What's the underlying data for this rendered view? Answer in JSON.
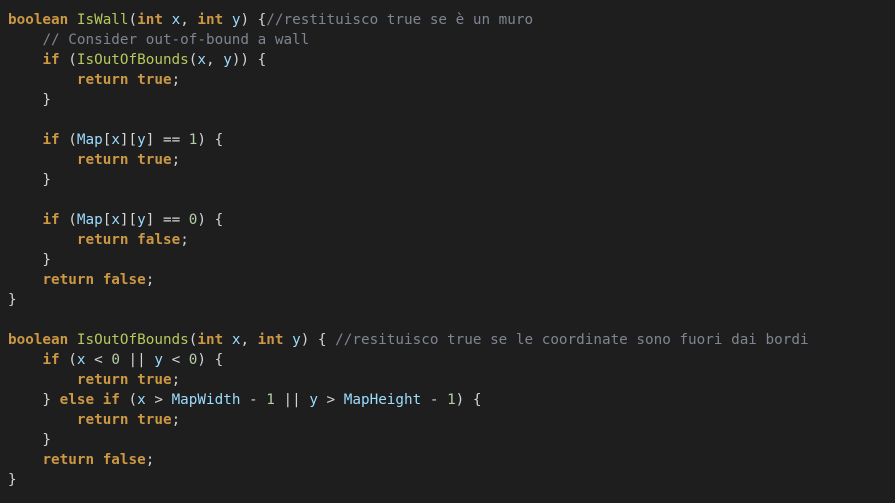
{
  "editor": {
    "background": "#1e1e1e",
    "colors": {
      "keyword": "#cc9844",
      "function": "#b5c95f",
      "variable": "#9cdcfe",
      "number": "#b5cea8",
      "comment": "#7e8590",
      "punctuation": "#d4d4d4"
    },
    "lines": [
      [
        [
          "kw",
          "boolean"
        ],
        [
          "p",
          " "
        ],
        [
          "fn",
          "IsWall"
        ],
        [
          "p",
          "("
        ],
        [
          "kw",
          "int"
        ],
        [
          "p",
          " "
        ],
        [
          "var",
          "x"
        ],
        [
          "p",
          ", "
        ],
        [
          "kw",
          "int"
        ],
        [
          "p",
          " "
        ],
        [
          "var",
          "y"
        ],
        [
          "p",
          ") {"
        ],
        [
          "cm",
          "//restituisco true se è un muro"
        ]
      ],
      [
        [
          "p",
          "    "
        ],
        [
          "cm",
          "// Consider out-of-bound a wall"
        ]
      ],
      [
        [
          "p",
          "    "
        ],
        [
          "kw",
          "if"
        ],
        [
          "p",
          " ("
        ],
        [
          "fn",
          "IsOutOfBounds"
        ],
        [
          "p",
          "("
        ],
        [
          "var",
          "x"
        ],
        [
          "p",
          ", "
        ],
        [
          "var",
          "y"
        ],
        [
          "p",
          ")) {"
        ]
      ],
      [
        [
          "p",
          "        "
        ],
        [
          "kw",
          "return"
        ],
        [
          "p",
          " "
        ],
        [
          "kw",
          "true"
        ],
        [
          "p",
          ";"
        ]
      ],
      [
        [
          "p",
          "    }"
        ]
      ],
      [],
      [
        [
          "p",
          "    "
        ],
        [
          "kw",
          "if"
        ],
        [
          "p",
          " ("
        ],
        [
          "var",
          "Map"
        ],
        [
          "p",
          "["
        ],
        [
          "var",
          "x"
        ],
        [
          "p",
          "]["
        ],
        [
          "var",
          "y"
        ],
        [
          "p",
          "] == "
        ],
        [
          "num",
          "1"
        ],
        [
          "p",
          ") {"
        ]
      ],
      [
        [
          "p",
          "        "
        ],
        [
          "kw",
          "return"
        ],
        [
          "p",
          " "
        ],
        [
          "kw",
          "true"
        ],
        [
          "p",
          ";"
        ]
      ],
      [
        [
          "p",
          "    }"
        ]
      ],
      [],
      [
        [
          "p",
          "    "
        ],
        [
          "kw",
          "if"
        ],
        [
          "p",
          " ("
        ],
        [
          "var",
          "Map"
        ],
        [
          "p",
          "["
        ],
        [
          "var",
          "x"
        ],
        [
          "p",
          "]["
        ],
        [
          "var",
          "y"
        ],
        [
          "p",
          "] == "
        ],
        [
          "num",
          "0"
        ],
        [
          "p",
          ") {"
        ]
      ],
      [
        [
          "p",
          "        "
        ],
        [
          "kw",
          "return"
        ],
        [
          "p",
          " "
        ],
        [
          "kw",
          "false"
        ],
        [
          "p",
          ";"
        ]
      ],
      [
        [
          "p",
          "    }"
        ]
      ],
      [
        [
          "p",
          "    "
        ],
        [
          "kw",
          "return"
        ],
        [
          "p",
          " "
        ],
        [
          "kw",
          "false"
        ],
        [
          "p",
          ";"
        ]
      ],
      [
        [
          "p",
          "}"
        ]
      ],
      [],
      [
        [
          "kw",
          "boolean"
        ],
        [
          "p",
          " "
        ],
        [
          "fn",
          "IsOutOfBounds"
        ],
        [
          "p",
          "("
        ],
        [
          "kw",
          "int"
        ],
        [
          "p",
          " "
        ],
        [
          "var",
          "x"
        ],
        [
          "p",
          ", "
        ],
        [
          "kw",
          "int"
        ],
        [
          "p",
          " "
        ],
        [
          "var",
          "y"
        ],
        [
          "p",
          ") { "
        ],
        [
          "cm",
          "//resituisco true se le coordinate sono fuori dai bordi"
        ]
      ],
      [
        [
          "p",
          "    "
        ],
        [
          "kw",
          "if"
        ],
        [
          "p",
          " ("
        ],
        [
          "var",
          "x"
        ],
        [
          "p",
          " < "
        ],
        [
          "num",
          "0"
        ],
        [
          "p",
          " || "
        ],
        [
          "var",
          "y"
        ],
        [
          "p",
          " < "
        ],
        [
          "num",
          "0"
        ],
        [
          "p",
          ") {"
        ]
      ],
      [
        [
          "p",
          "        "
        ],
        [
          "kw",
          "return"
        ],
        [
          "p",
          " "
        ],
        [
          "kw",
          "true"
        ],
        [
          "p",
          ";"
        ]
      ],
      [
        [
          "p",
          "    } "
        ],
        [
          "kw",
          "else"
        ],
        [
          "p",
          " "
        ],
        [
          "kw",
          "if"
        ],
        [
          "p",
          " ("
        ],
        [
          "var",
          "x"
        ],
        [
          "p",
          " > "
        ],
        [
          "var",
          "MapWidth"
        ],
        [
          "p",
          " - "
        ],
        [
          "num",
          "1"
        ],
        [
          "p",
          " || "
        ],
        [
          "var",
          "y"
        ],
        [
          "p",
          " > "
        ],
        [
          "var",
          "MapHeight"
        ],
        [
          "p",
          " - "
        ],
        [
          "num",
          "1"
        ],
        [
          "p",
          ") {"
        ]
      ],
      [
        [
          "p",
          "        "
        ],
        [
          "kw",
          "return"
        ],
        [
          "p",
          " "
        ],
        [
          "kw",
          "true"
        ],
        [
          "p",
          ";"
        ]
      ],
      [
        [
          "p",
          "    }"
        ]
      ],
      [
        [
          "p",
          "    "
        ],
        [
          "kw",
          "return"
        ],
        [
          "p",
          " "
        ],
        [
          "kw",
          "false"
        ],
        [
          "p",
          ";"
        ]
      ],
      [
        [
          "p",
          "}"
        ]
      ]
    ]
  }
}
